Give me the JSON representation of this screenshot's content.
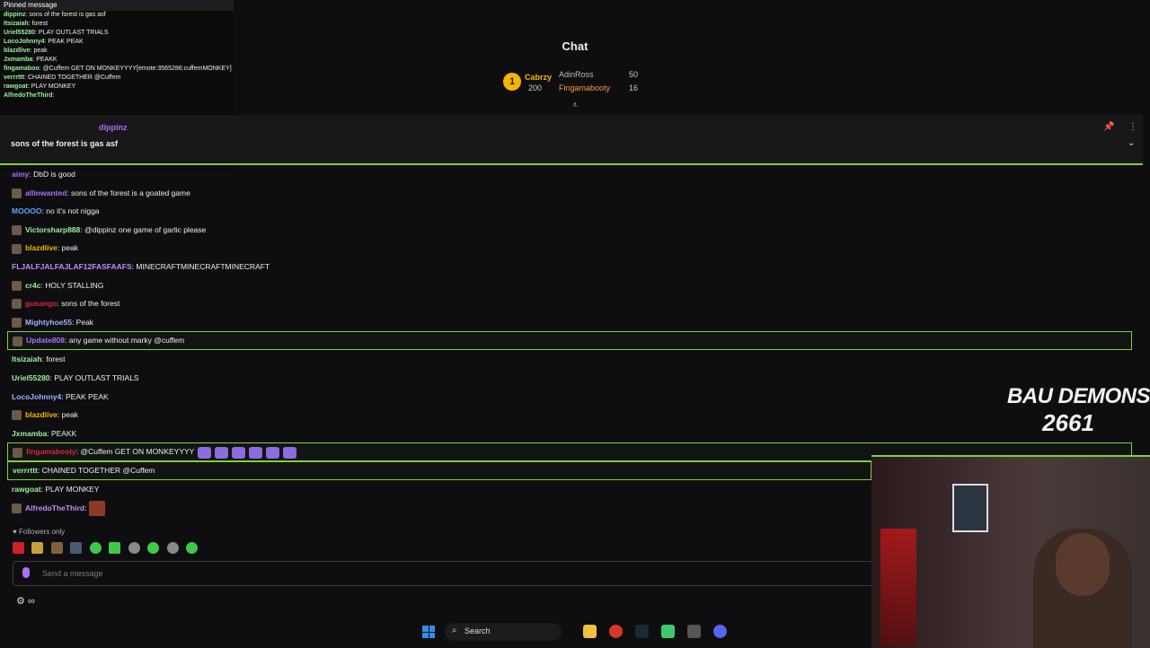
{
  "mini_chat": {
    "pinned_label": "Pinned message",
    "rows": [
      {
        "user": "dippinz",
        "text": "sons of the forest is gas asf"
      },
      {
        "user": "Itsizaiah",
        "text": "forest"
      },
      {
        "user": "Uriel55280",
        "text": "PLAY OUTLAST TRIALS"
      },
      {
        "user": "LocoJohnny4",
        "text": "PEAK PEAK"
      },
      {
        "user": "blazdlive",
        "text": "peak"
      },
      {
        "user": "Jxmamba",
        "text": "PEAKK"
      },
      {
        "user": "fingamaboo",
        "text": "@Cuffem GET ON MONKEYYYY[emote:3565286:cuffemMONKEY]"
      },
      {
        "user": "verrrttt",
        "text": "CHAINED TOGETHER @Cuffem"
      },
      {
        "user": "rawgoat",
        "text": "PLAY MONKEY"
      },
      {
        "user": "AlfredoTheThird",
        "text": ""
      }
    ]
  },
  "header": {
    "title": "Chat"
  },
  "leaderboard": {
    "rank": "1",
    "first": {
      "name": "Cabrzy",
      "count": "200"
    },
    "second": {
      "name": "AdinRoss",
      "count": "50"
    },
    "third": {
      "name": "Fingamabooty",
      "count": "16"
    }
  },
  "pinned": {
    "user": "dippinz",
    "message": "sons of the forest is gas asf"
  },
  "messages": [
    {
      "user": "aimy",
      "color": "#a970ff",
      "text": ": DbD is good",
      "badge": false,
      "style": ""
    },
    {
      "user": "allinwanted",
      "color": "#a970ff",
      "text": ": sons of the forest is a goated game",
      "badge": true,
      "style": ""
    },
    {
      "user": "MOOOO",
      "color": "#5aa7ff",
      "text": ": no it's not nigga",
      "badge": false,
      "style": ""
    },
    {
      "user": "Victorsharp888",
      "color": "#9cf19c",
      "text": ": @dippinz one game of garlic please",
      "badge": true,
      "style": ""
    },
    {
      "user": "blazdlive",
      "color": "#f5b400",
      "text": ": peak",
      "badge": true,
      "style": ""
    },
    {
      "user": "FLJALFJALFAJLAF12FASFAAFS",
      "color": "#c58af9",
      "text": ": MINECRAFTMINECRAFTMINECRAFT",
      "badge": false,
      "style": ""
    },
    {
      "user": "cr4c",
      "color": "#9cf19c",
      "text": ": HOLY STALLING",
      "badge": true,
      "style": ""
    },
    {
      "user": "gusango",
      "color": "#e0223c",
      "text": ": sons of the forest",
      "badge": true,
      "style": ""
    },
    {
      "user": "Mightyhoe55",
      "color": "#9fb2ff",
      "text": ": Peak",
      "badge": true,
      "style": ""
    },
    {
      "user": "Update808",
      "color": "#a970ff",
      "text": ": any game without marky @cuffem",
      "badge": true,
      "style": "hl"
    },
    {
      "user": "Itsizaiah",
      "color": "#9cf19c",
      "text": ": forest",
      "badge": false,
      "style": ""
    },
    {
      "user": "Uriel55280",
      "color": "#9cf19c",
      "text": ": PLAY OUTLAST TRIALS",
      "badge": false,
      "style": ""
    },
    {
      "user": "LocoJohnny4",
      "color": "#9fb2ff",
      "text": ": PEAK PEAK",
      "badge": false,
      "style": ""
    },
    {
      "user": "blazdlive",
      "color": "#f5b400",
      "text": ": peak",
      "badge": true,
      "style": ""
    },
    {
      "user": "Jxmamba",
      "color": "#9cf19c",
      "text": ": PEAKK",
      "badge": false,
      "style": ""
    },
    {
      "user": "fingamabooty",
      "color": "#e0223c",
      "text": ": @Cuffem GET ON MONKEYYYY",
      "badge": true,
      "style": "hl",
      "emotes": 6
    },
    {
      "user": "verrrttt",
      "color": "#9cf19c",
      "text": ": CHAINED TOGETHER @Cuffem",
      "badge": false,
      "style": "hl2"
    },
    {
      "user": "rawgoat",
      "color": "#9cf19c",
      "text": ": PLAY MONKEY",
      "badge": false,
      "style": ""
    },
    {
      "user": "AlfredoTheThird",
      "color": "#c58af9",
      "text": ":",
      "badge": true,
      "style": "",
      "image_emote": true
    }
  ],
  "footer": {
    "followers_only": "Followers only",
    "input_placeholder": "Send a message"
  },
  "overlay": {
    "line1": "BAU DEMONS",
    "line2": "2661"
  },
  "taskbar": {
    "search_label": "Search"
  },
  "colors": {
    "accent_green": "#7fd13a",
    "twitch_purple": "#a970ff",
    "gold": "#f5b400"
  }
}
